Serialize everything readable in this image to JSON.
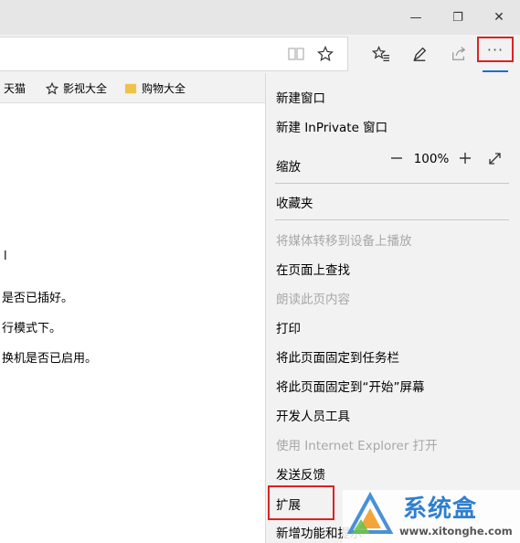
{
  "window": {
    "minimize_glyph": "—",
    "restore_glyph": "❐",
    "close_glyph": "✕"
  },
  "toolbar": {
    "more_label": "···",
    "icons": [
      "reading-view-icon",
      "favorite-star-icon",
      "favorites-hub-icon",
      "web-note-icon",
      "share-icon"
    ]
  },
  "favorites_bar": {
    "items": [
      {
        "label": "天猫",
        "icon": "star-icon"
      },
      {
        "label": "影视大全",
        "icon": "star-icon"
      },
      {
        "label": "购物大全",
        "icon": "folder-icon"
      }
    ]
  },
  "page_content": {
    "lines": [
      "l",
      "是否已插好。",
      "行模式下。",
      "换机是否已启用。"
    ]
  },
  "menu": {
    "new_window": "新建窗口",
    "new_inprivate": "新建 InPrivate 窗口",
    "zoom_label": "缩放",
    "zoom_value": "100%",
    "favorites": "收藏夹",
    "cast_media": "将媒体转移到设备上播放",
    "find_on_page": "在页面上查找",
    "read_aloud": "朗读此页内容",
    "print": "打印",
    "pin_taskbar": "将此页面固定到任务栏",
    "pin_start": "将此页面固定到“开始”屏幕",
    "dev_tools": "开发人员工具",
    "open_ie": "使用 Internet Explorer 打开",
    "send_feedback": "发送反馈",
    "extensions": "扩展",
    "whats_new": "新增功能和提示"
  },
  "watermark": {
    "brand": "系统盒",
    "url": "www.xitonghe.com"
  },
  "colors": {
    "highlight_red": "#d22222",
    "accent_blue": "#1e6cd6",
    "menu_bg": "#f2f2f2",
    "disabled_text": "#a8a8a8"
  }
}
